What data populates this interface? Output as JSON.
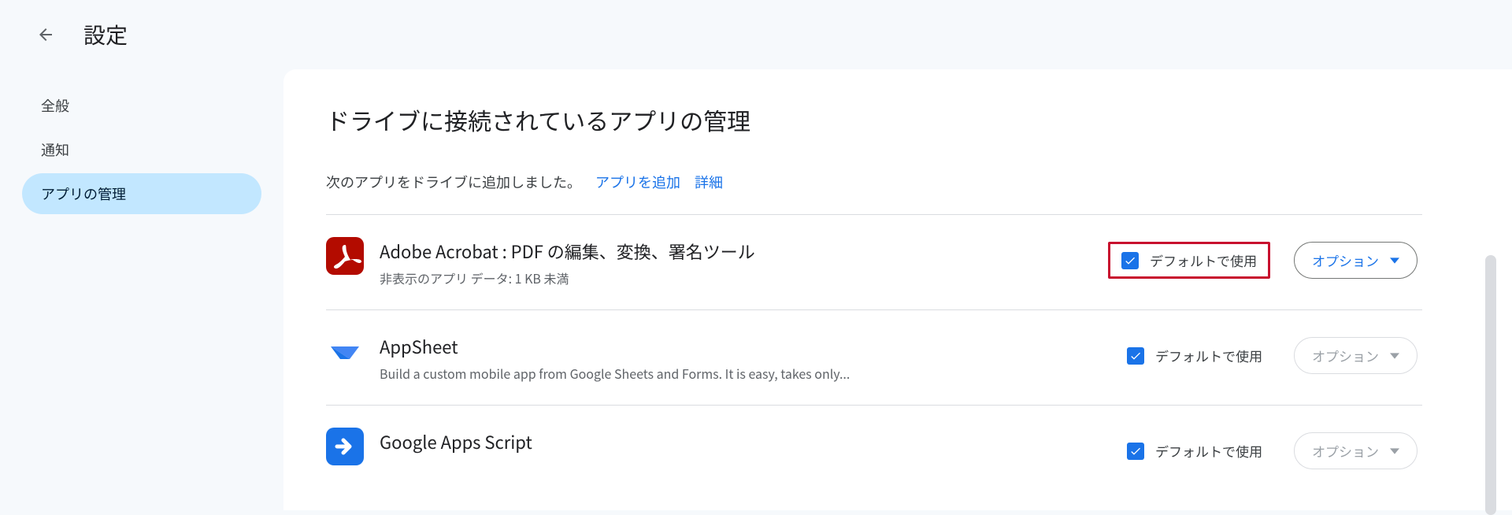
{
  "header": {
    "title": "設定"
  },
  "sidebar": {
    "items": [
      {
        "label": "全般",
        "active": false
      },
      {
        "label": "通知",
        "active": false
      },
      {
        "label": "アプリの管理",
        "active": true
      }
    ]
  },
  "main": {
    "title": "ドライブに接続されているアプリの管理",
    "intro_text": "次のアプリをドライブに追加しました。",
    "add_link": "アプリを追加",
    "details_link": "詳細",
    "default_label": "デフォルトで使用",
    "option_label": "オプション",
    "apps": [
      {
        "name": "Adobe Acrobat : PDF の編集、変換、署名ツール",
        "sub": "非表示のアプリ データ: 1 KB 未満",
        "default_checked": true,
        "option_enabled": true,
        "highlight": true,
        "icon": "acrobat"
      },
      {
        "name": "AppSheet",
        "sub": "Build a custom mobile app from Google Sheets and Forms. It is easy, takes only...",
        "default_checked": true,
        "option_enabled": false,
        "highlight": false,
        "icon": "appsheet"
      },
      {
        "name": "Google Apps Script",
        "sub": "",
        "default_checked": true,
        "option_enabled": false,
        "highlight": false,
        "icon": "appsscript"
      }
    ]
  }
}
